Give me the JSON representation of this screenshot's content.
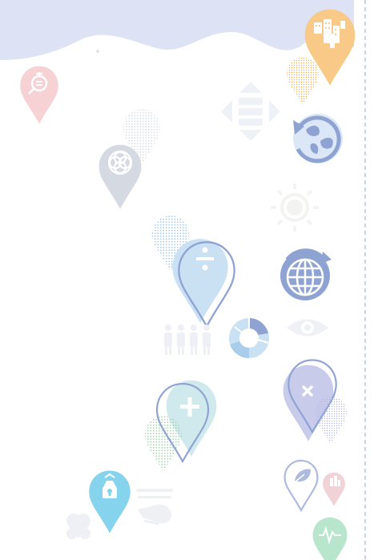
{
  "colors": {
    "wave": "#dde3f4",
    "dashed_line": "#a9b4d8",
    "orange": "#f8c987",
    "orange_dots": "#f0b04f",
    "pink": "#f6d2d4",
    "pink_icon": "#ef9ea6",
    "gray": "#d5d9e2",
    "gray_dots": "#e2e5ec",
    "blue": "#c9e1f3",
    "blue_outline": "#8fa3d3",
    "blue_dots": "#a9cdea",
    "navy": "#7d8fcc",
    "teal": "#cfe9ec",
    "green_dots": "#a9d8b2",
    "cyan": "#86d3ee",
    "purple_light": "#c8cbea",
    "mint": "#b8e6cc",
    "faint": "#eef1f6"
  },
  "icons": [
    "city-pin-icon",
    "gender-equality-pin-icon",
    "fish-water-icon",
    "arrows-cross-icon",
    "flower-pin-icon",
    "leaf-cycle-icon",
    "sun-icon",
    "divide-pin-icon",
    "globe-arrow-icon",
    "people-icon",
    "donut-chart-icon",
    "eye-icon",
    "multiply-pin-icon",
    "plus-pin-icon",
    "leaf-pin-icon",
    "building-pin-icon",
    "bank-pin-icon",
    "handshake-icon",
    "hands-heart-icon",
    "heartbeat-pin-icon"
  ]
}
